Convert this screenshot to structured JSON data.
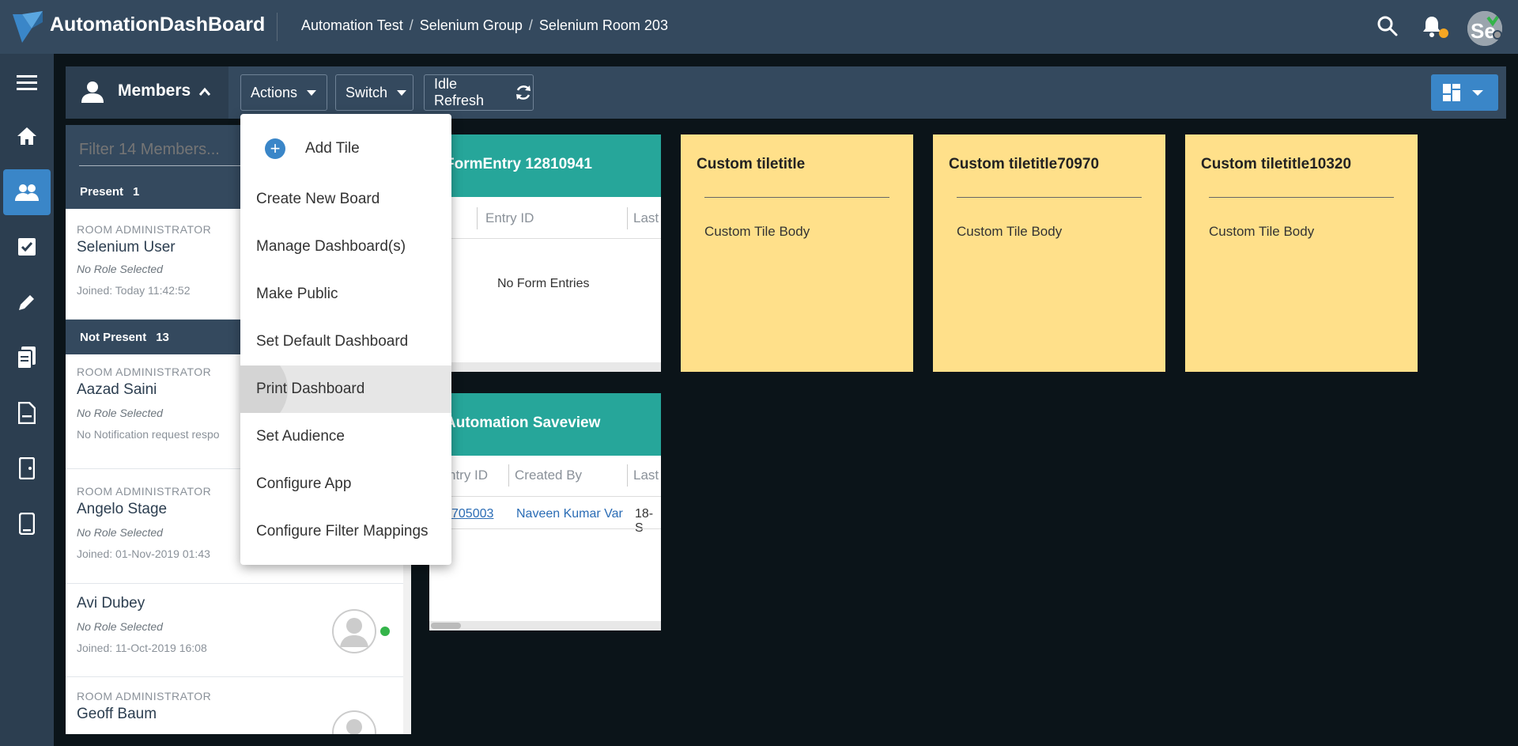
{
  "app": {
    "title": "AutomationDashBoard"
  },
  "breadcrumb": [
    "Automation Test",
    "Selenium Group",
    "Selenium Room 203"
  ],
  "user": {
    "initials": "Se"
  },
  "toolbar": {
    "members_label": "Members",
    "actions_label": "Actions",
    "switch_label": "Switch",
    "idle_refresh_label": "Idle Refresh"
  },
  "members_panel": {
    "filter_placeholder": "Filter 14 Members...",
    "present": {
      "label": "Present",
      "count": "1"
    },
    "not_present": {
      "label": "Not Present",
      "count": "13"
    },
    "members": [
      {
        "role": "ROOM ADMINISTRATOR",
        "name": "Selenium User",
        "role_status": "No Role Selected",
        "detail": "Joined: Today 11:42:52"
      },
      {
        "role": "ROOM ADMINISTRATOR",
        "name": "Aazad Saini",
        "role_status": "No Role Selected",
        "detail": "No Notification request respo"
      },
      {
        "role": "ROOM ADMINISTRATOR",
        "name": "Angelo Stage",
        "role_status": "No Role Selected",
        "detail": "Joined: 01-Nov-2019 01:43"
      },
      {
        "role": "",
        "name": "Avi Dubey",
        "role_status": "No Role Selected",
        "detail": "Joined: 11-Oct-2019 16:08"
      },
      {
        "role": "ROOM ADMINISTRATOR",
        "name": "Geoff Baum",
        "role_status": "",
        "detail": ""
      }
    ]
  },
  "actions_menu": {
    "items": [
      "Add Tile",
      "Create New Board",
      "Manage Dashboard(s)",
      "Make Public",
      "Set Default Dashboard",
      "Print Dashboard",
      "Set Audience",
      "Configure App",
      "Configure Filter Mappings"
    ],
    "hovered": "Print Dashboard"
  },
  "tiles": {
    "form_entry": {
      "title": "FormEntry 12810941",
      "col_entry_id": "Entry ID",
      "col_last": "Last",
      "empty_message": "No Form Entries"
    },
    "saveview": {
      "title": "Automation Saveview",
      "col_entry_id": "ntry ID",
      "col_created_by": "Created By",
      "col_last": "Last",
      "row_entry_id": "705003",
      "row_created_by": "Naveen Kumar Var",
      "row_last": "18-S"
    },
    "custom": [
      {
        "title": "Custom tiletitle",
        "body": "Custom Tile Body"
      },
      {
        "title": "Custom tiletitle70970",
        "body": "Custom Tile Body"
      },
      {
        "title": "Custom tiletitle10320",
        "body": "Custom Tile Body"
      }
    ]
  },
  "colors": {
    "header": "#34495e",
    "nav": "#2c3e50",
    "accent": "#3a86c8",
    "tile_teal": "#26a69a",
    "tile_yellow": "#ffe08a",
    "online": "#34b44a",
    "notification": "#f5a623"
  }
}
